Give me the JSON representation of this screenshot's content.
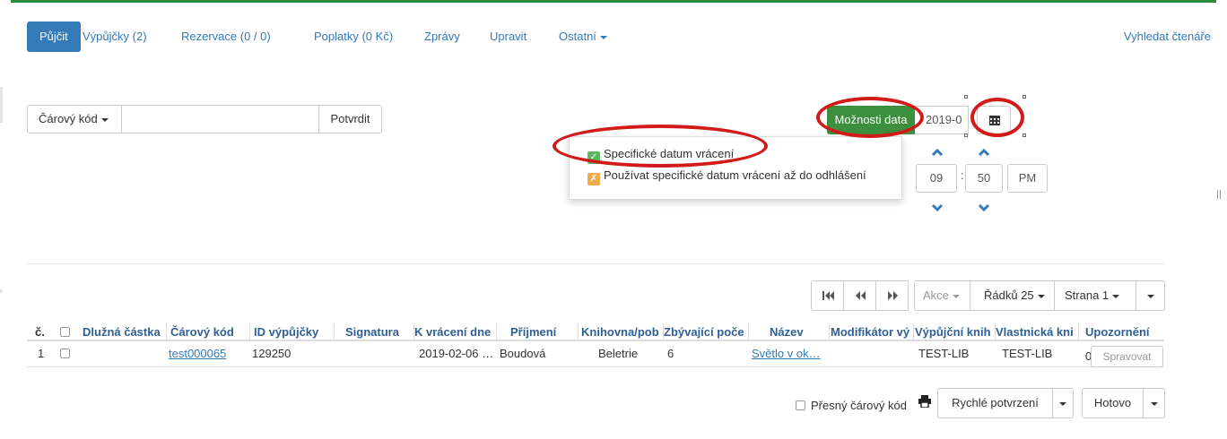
{
  "nav": {
    "tabs": [
      {
        "label": "Půjčit"
      },
      {
        "label": "Výpůjčky (2)"
      },
      {
        "label": "Rezervace (0 / 0)"
      },
      {
        "label": "Poplatky (0 Kč)"
      },
      {
        "label": "Zprávy"
      },
      {
        "label": "Upravit"
      },
      {
        "label": "Ostatní"
      }
    ],
    "right_link": "Vyhledat čtenáře"
  },
  "checkout": {
    "barcode_type": "Čárový kód",
    "barcode_value": "",
    "submit_label": "Potvrdit"
  },
  "date_options": {
    "button_label": "Možnosti data",
    "date_value": "2019-0",
    "menu_items": [
      {
        "label": "Specifické datum vrácení",
        "checked": true
      },
      {
        "label": "Používat specifické datum vrácení až do odhlášení",
        "checked": false
      }
    ],
    "hour": "09",
    "minute": "50",
    "period": "PM"
  },
  "pager": {
    "actions_label": "Akce",
    "rows_label": "Řádků 25",
    "page_label": "Strana 1"
  },
  "table": {
    "columns": [
      "č.",
      "Dlužná částka",
      "Čárový kód",
      "ID výpůjčky",
      "Signatura",
      "K vrácení dne",
      "Příjmení",
      "Knihovna/pob",
      "Zbývající poče",
      "Název",
      "Modifikátor vý",
      "Výpůjční knih",
      "Vlastnická kni",
      "Upozornění"
    ],
    "rows": [
      {
        "num": "1",
        "amount": "",
        "barcode": "test000065",
        "loan_id": "129250",
        "call_number": "",
        "due_date": "2019-02-06 …",
        "surname": "Boudová",
        "library": "Beletrie",
        "remaining": "6",
        "title": "Světlo v ok…",
        "modifier": "",
        "circ_lib": "TEST-LIB",
        "owning_lib": "TEST-LIB",
        "alerts": "0",
        "manage_label": "Spravovat"
      }
    ]
  },
  "footer": {
    "exact_barcode_label": "Přesný čárový kód",
    "quick_receipt_label": "Rychlé potvrzení",
    "done_label": "Hotovo"
  },
  "colors": {
    "nav_active": "#337ab7",
    "date_button": "#3c8f3c",
    "annotation_ring": "#d11a1a",
    "header_text": "#2f5f94"
  }
}
